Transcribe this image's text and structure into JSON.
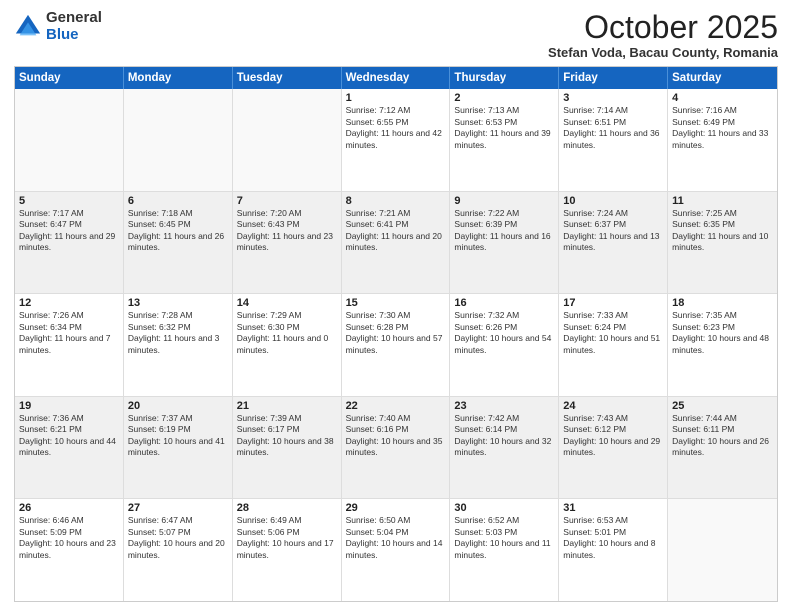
{
  "logo": {
    "general": "General",
    "blue": "Blue"
  },
  "header": {
    "month": "October 2025",
    "location": "Stefan Voda, Bacau County, Romania"
  },
  "days": [
    "Sunday",
    "Monday",
    "Tuesday",
    "Wednesday",
    "Thursday",
    "Friday",
    "Saturday"
  ],
  "weeks": [
    [
      {
        "day": "",
        "text": ""
      },
      {
        "day": "",
        "text": ""
      },
      {
        "day": "",
        "text": ""
      },
      {
        "day": "1",
        "text": "Sunrise: 7:12 AM\nSunset: 6:55 PM\nDaylight: 11 hours and 42 minutes."
      },
      {
        "day": "2",
        "text": "Sunrise: 7:13 AM\nSunset: 6:53 PM\nDaylight: 11 hours and 39 minutes."
      },
      {
        "day": "3",
        "text": "Sunrise: 7:14 AM\nSunset: 6:51 PM\nDaylight: 11 hours and 36 minutes."
      },
      {
        "day": "4",
        "text": "Sunrise: 7:16 AM\nSunset: 6:49 PM\nDaylight: 11 hours and 33 minutes."
      }
    ],
    [
      {
        "day": "5",
        "text": "Sunrise: 7:17 AM\nSunset: 6:47 PM\nDaylight: 11 hours and 29 minutes."
      },
      {
        "day": "6",
        "text": "Sunrise: 7:18 AM\nSunset: 6:45 PM\nDaylight: 11 hours and 26 minutes."
      },
      {
        "day": "7",
        "text": "Sunrise: 7:20 AM\nSunset: 6:43 PM\nDaylight: 11 hours and 23 minutes."
      },
      {
        "day": "8",
        "text": "Sunrise: 7:21 AM\nSunset: 6:41 PM\nDaylight: 11 hours and 20 minutes."
      },
      {
        "day": "9",
        "text": "Sunrise: 7:22 AM\nSunset: 6:39 PM\nDaylight: 11 hours and 16 minutes."
      },
      {
        "day": "10",
        "text": "Sunrise: 7:24 AM\nSunset: 6:37 PM\nDaylight: 11 hours and 13 minutes."
      },
      {
        "day": "11",
        "text": "Sunrise: 7:25 AM\nSunset: 6:35 PM\nDaylight: 11 hours and 10 minutes."
      }
    ],
    [
      {
        "day": "12",
        "text": "Sunrise: 7:26 AM\nSunset: 6:34 PM\nDaylight: 11 hours and 7 minutes."
      },
      {
        "day": "13",
        "text": "Sunrise: 7:28 AM\nSunset: 6:32 PM\nDaylight: 11 hours and 3 minutes."
      },
      {
        "day": "14",
        "text": "Sunrise: 7:29 AM\nSunset: 6:30 PM\nDaylight: 11 hours and 0 minutes."
      },
      {
        "day": "15",
        "text": "Sunrise: 7:30 AM\nSunset: 6:28 PM\nDaylight: 10 hours and 57 minutes."
      },
      {
        "day": "16",
        "text": "Sunrise: 7:32 AM\nSunset: 6:26 PM\nDaylight: 10 hours and 54 minutes."
      },
      {
        "day": "17",
        "text": "Sunrise: 7:33 AM\nSunset: 6:24 PM\nDaylight: 10 hours and 51 minutes."
      },
      {
        "day": "18",
        "text": "Sunrise: 7:35 AM\nSunset: 6:23 PM\nDaylight: 10 hours and 48 minutes."
      }
    ],
    [
      {
        "day": "19",
        "text": "Sunrise: 7:36 AM\nSunset: 6:21 PM\nDaylight: 10 hours and 44 minutes."
      },
      {
        "day": "20",
        "text": "Sunrise: 7:37 AM\nSunset: 6:19 PM\nDaylight: 10 hours and 41 minutes."
      },
      {
        "day": "21",
        "text": "Sunrise: 7:39 AM\nSunset: 6:17 PM\nDaylight: 10 hours and 38 minutes."
      },
      {
        "day": "22",
        "text": "Sunrise: 7:40 AM\nSunset: 6:16 PM\nDaylight: 10 hours and 35 minutes."
      },
      {
        "day": "23",
        "text": "Sunrise: 7:42 AM\nSunset: 6:14 PM\nDaylight: 10 hours and 32 minutes."
      },
      {
        "day": "24",
        "text": "Sunrise: 7:43 AM\nSunset: 6:12 PM\nDaylight: 10 hours and 29 minutes."
      },
      {
        "day": "25",
        "text": "Sunrise: 7:44 AM\nSunset: 6:11 PM\nDaylight: 10 hours and 26 minutes."
      }
    ],
    [
      {
        "day": "26",
        "text": "Sunrise: 6:46 AM\nSunset: 5:09 PM\nDaylight: 10 hours and 23 minutes."
      },
      {
        "day": "27",
        "text": "Sunrise: 6:47 AM\nSunset: 5:07 PM\nDaylight: 10 hours and 20 minutes."
      },
      {
        "day": "28",
        "text": "Sunrise: 6:49 AM\nSunset: 5:06 PM\nDaylight: 10 hours and 17 minutes."
      },
      {
        "day": "29",
        "text": "Sunrise: 6:50 AM\nSunset: 5:04 PM\nDaylight: 10 hours and 14 minutes."
      },
      {
        "day": "30",
        "text": "Sunrise: 6:52 AM\nSunset: 5:03 PM\nDaylight: 10 hours and 11 minutes."
      },
      {
        "day": "31",
        "text": "Sunrise: 6:53 AM\nSunset: 5:01 PM\nDaylight: 10 hours and 8 minutes."
      },
      {
        "day": "",
        "text": ""
      }
    ]
  ]
}
